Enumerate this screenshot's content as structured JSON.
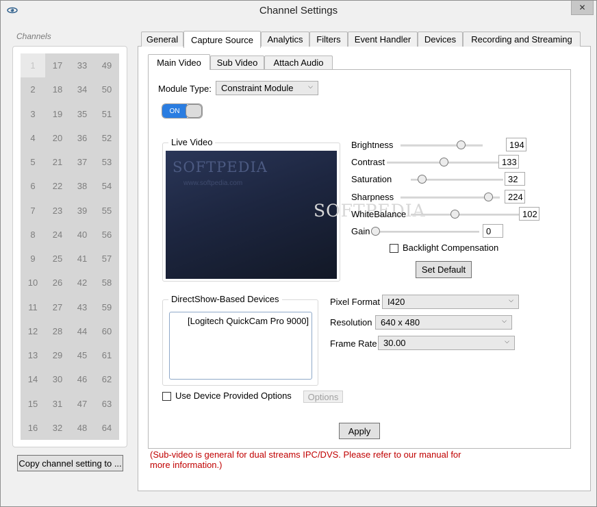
{
  "window": {
    "title": "Channel Settings",
    "close_glyph": "✕"
  },
  "channels": {
    "label": "Channels",
    "selected": "1",
    "cells": [
      "1",
      "17",
      "33",
      "49",
      "2",
      "18",
      "34",
      "50",
      "3",
      "19",
      "35",
      "51",
      "4",
      "20",
      "36",
      "52",
      "5",
      "21",
      "37",
      "53",
      "6",
      "22",
      "38",
      "54",
      "7",
      "23",
      "39",
      "55",
      "8",
      "24",
      "40",
      "56",
      "9",
      "25",
      "41",
      "57",
      "10",
      "26",
      "42",
      "58",
      "11",
      "27",
      "43",
      "59",
      "12",
      "28",
      "44",
      "60",
      "13",
      "29",
      "45",
      "61",
      "14",
      "30",
      "46",
      "62",
      "15",
      "31",
      "47",
      "63",
      "16",
      "32",
      "48",
      "64"
    ],
    "copy_button": "Copy channel setting to ..."
  },
  "tabs": [
    "General",
    "Capture Source",
    "Analytics",
    "Filters",
    "Event Handler",
    "Devices",
    "Recording and Streaming"
  ],
  "active_tab": "Capture Source",
  "subtabs": [
    "Main Video",
    "Sub Video",
    "Attach Audio"
  ],
  "active_subtab": "Main Video",
  "module": {
    "label": "Module Type:",
    "value": "Constraint Module"
  },
  "toggle": {
    "label": "ON",
    "state": true
  },
  "live_video": {
    "title": "Live Video",
    "watermark": "SOFTPEDIA",
    "watermark_url": "www.softpedia.com"
  },
  "ghost_watermark": "SOFTPEDIA",
  "sliders": [
    {
      "label": "Brightness",
      "value": "194",
      "fraction": 0.73
    },
    {
      "label": "Contrast",
      "value": "133",
      "fraction": 0.5
    },
    {
      "label": "Saturation",
      "value": "32",
      "fraction": 0.12
    },
    {
      "label": "Sharpness",
      "value": "224",
      "fraction": 0.88
    },
    {
      "label": "WhiteBalance",
      "value": "102",
      "fraction": 0.4
    },
    {
      "label": "Gain",
      "value": "0",
      "fraction": 0.0
    }
  ],
  "backlight": {
    "label": "Backlight Compensation",
    "checked": false
  },
  "set_default": "Set Default",
  "devices": {
    "title": "DirectShow-Based Devices",
    "items": [
      "[Logitech QuickCam Pro 9000]"
    ]
  },
  "pixel_format": {
    "label": "Pixel Format",
    "value": "I420"
  },
  "resolution": {
    "label": "Resolution",
    "value": "640 x 480"
  },
  "frame_rate": {
    "label": "Frame Rate",
    "value": "30.00"
  },
  "device_options": {
    "label": "Use Device Provided Options",
    "checked": false,
    "button": "Options"
  },
  "apply": "Apply",
  "note": "(Sub-video is general for dual streams IPC/DVS. Please refer to our manual for more information.)",
  "colors": {
    "accent": "#2a7de1",
    "note": "#c00000",
    "grid": "#d6d6d6"
  }
}
